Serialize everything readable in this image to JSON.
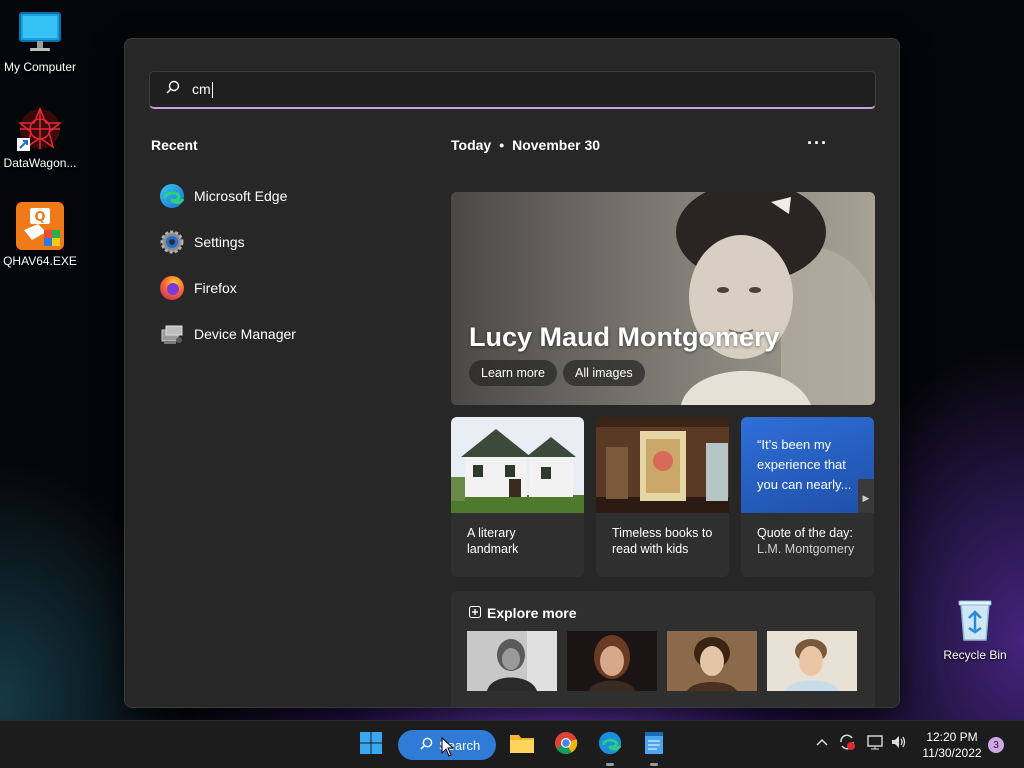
{
  "desktop": {
    "icons": [
      {
        "label": "My Computer"
      },
      {
        "label": "DataWagon..."
      },
      {
        "label": "QHAV64.EXE"
      },
      {
        "label": "Recycle Bin"
      }
    ]
  },
  "search": {
    "query": "cm"
  },
  "recent": {
    "title": "Recent",
    "items": [
      {
        "label": "Microsoft Edge",
        "icon": "edge-icon"
      },
      {
        "label": "Settings",
        "icon": "settings-gear-icon"
      },
      {
        "label": "Firefox",
        "icon": "firefox-icon"
      },
      {
        "label": "Device Manager",
        "icon": "device-manager-icon"
      }
    ]
  },
  "today": {
    "label": "Today",
    "date": "November 30",
    "more": "···"
  },
  "hero": {
    "title": "Lucy Maud Montgomery",
    "learn_more": "Learn more",
    "all_images": "All images"
  },
  "cards": [
    {
      "line1": "A literary",
      "line2": "landmark"
    },
    {
      "line1": "Timeless books to",
      "line2": "read with kids"
    },
    {
      "quote": "“It’s been my experience that you can nearly...",
      "line1": "Quote of the day:",
      "line2": "L.M. Montgomery"
    }
  ],
  "explore": {
    "title": "Explore more"
  },
  "taskbar": {
    "search_label": "Search",
    "time": "12:20 PM",
    "date": "11/30/2022",
    "notification_count": "3"
  },
  "colors": {
    "accent": "#2f7bd6",
    "search_underline": "#c9a0e6",
    "panel_bg": "#272727"
  }
}
